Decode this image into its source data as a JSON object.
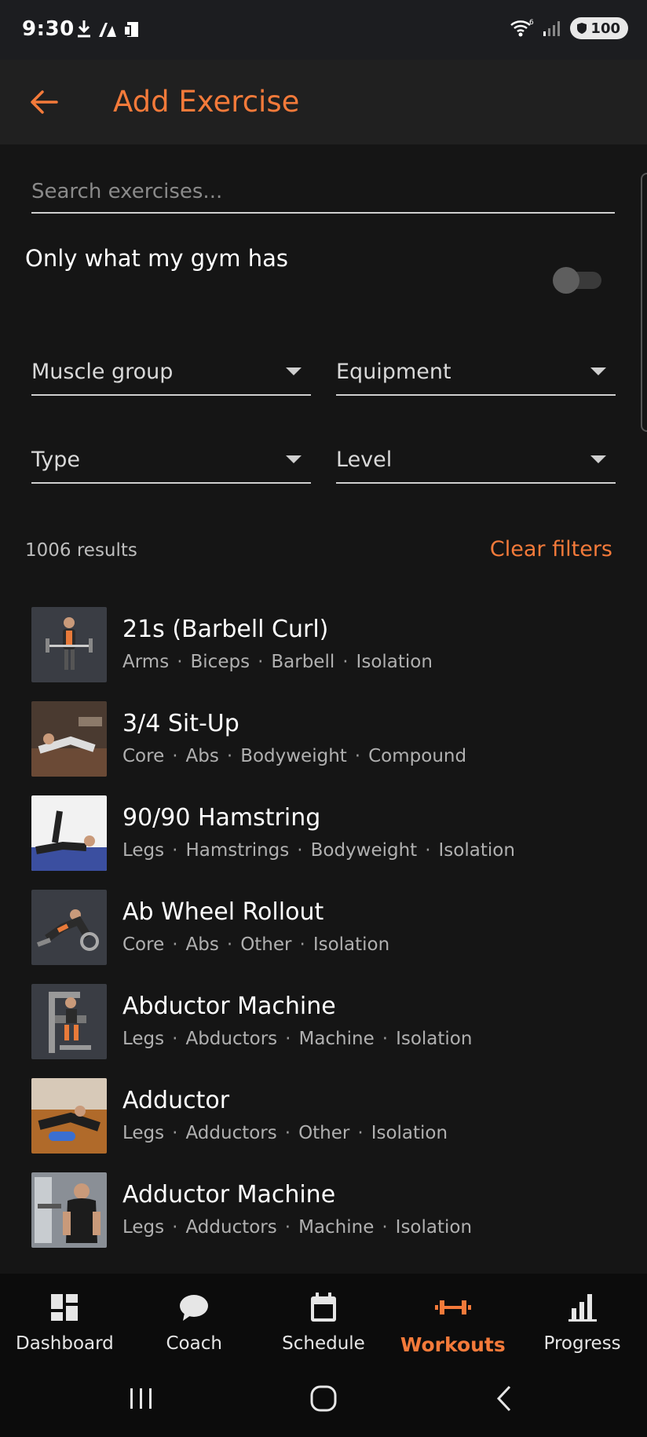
{
  "status_bar": {
    "time": "9:30",
    "battery": "100"
  },
  "app_bar": {
    "title": "Add Exercise"
  },
  "search": {
    "placeholder": "Search exercises..."
  },
  "gym_filter": {
    "label": "Only what my gym has",
    "enabled": false
  },
  "filters": {
    "muscle_group": "Muscle group",
    "equipment": "Equipment",
    "type": "Type",
    "level": "Level"
  },
  "results": {
    "count": "1006 results",
    "clear_label": "Clear filters"
  },
  "exercises": [
    {
      "name": "21s (Barbell Curl)",
      "tags": [
        "Arms",
        "Biceps",
        "Barbell",
        "Isolation"
      ]
    },
    {
      "name": "3/4 Sit-Up",
      "tags": [
        "Core",
        "Abs",
        "Bodyweight",
        "Compound"
      ]
    },
    {
      "name": "90/90 Hamstring",
      "tags": [
        "Legs",
        "Hamstrings",
        "Bodyweight",
        "Isolation"
      ]
    },
    {
      "name": "Ab Wheel Rollout",
      "tags": [
        "Core",
        "Abs",
        "Other",
        "Isolation"
      ]
    },
    {
      "name": "Abductor Machine",
      "tags": [
        "Legs",
        "Abductors",
        "Machine",
        "Isolation"
      ]
    },
    {
      "name": "Adductor",
      "tags": [
        "Legs",
        "Adductors",
        "Other",
        "Isolation"
      ]
    },
    {
      "name": "Adductor Machine",
      "tags": [
        "Legs",
        "Adductors",
        "Machine",
        "Isolation"
      ]
    }
  ],
  "bottom_nav": [
    {
      "label": "Dashboard",
      "icon": "dashboard-icon",
      "active": false
    },
    {
      "label": "Coach",
      "icon": "chat-icon",
      "active": false
    },
    {
      "label": "Schedule",
      "icon": "calendar-icon",
      "active": false
    },
    {
      "label": "Workouts",
      "icon": "dumbbell-icon",
      "active": true
    },
    {
      "label": "Progress",
      "icon": "bar-chart-icon",
      "active": false
    }
  ],
  "colors": {
    "accent": "#f47a3a",
    "background": "#151515",
    "appbar": "#202020"
  }
}
